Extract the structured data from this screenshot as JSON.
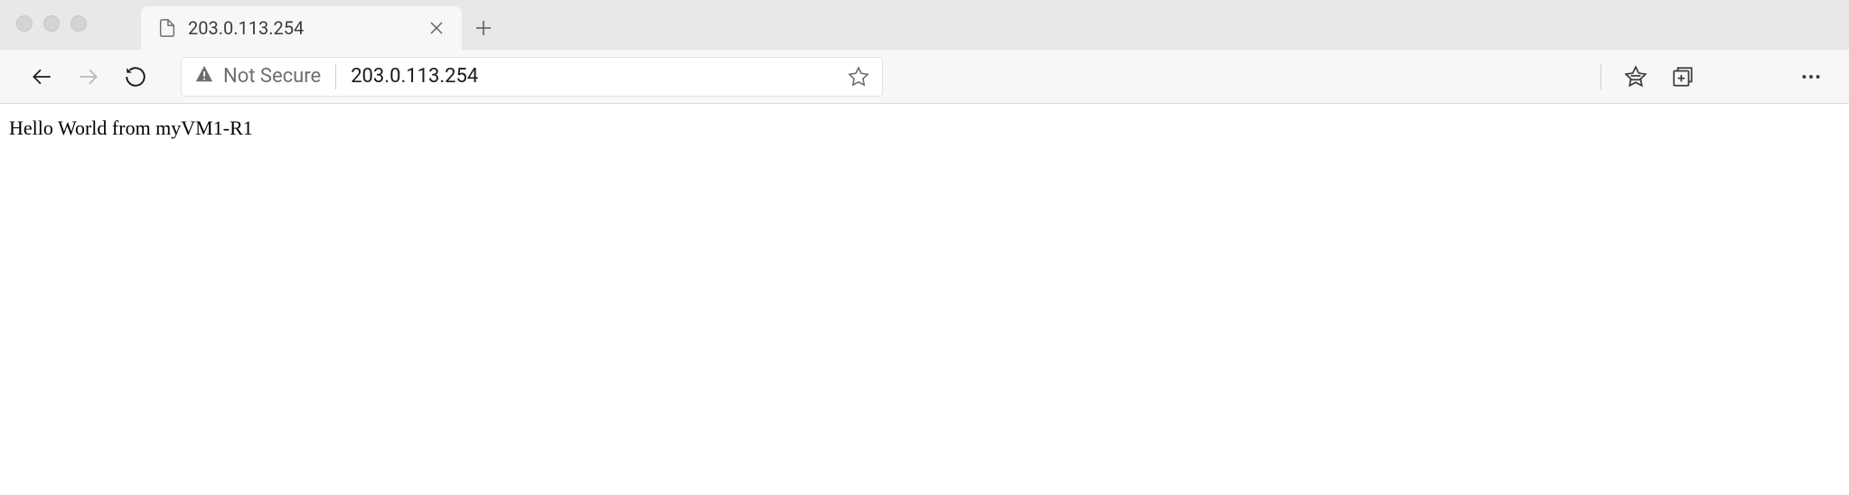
{
  "tab": {
    "title": "203.0.113.254"
  },
  "addressBar": {
    "securityLabel": "Not Secure",
    "url": "203.0.113.254"
  },
  "page": {
    "bodyText": "Hello World from myVM1-R1"
  }
}
